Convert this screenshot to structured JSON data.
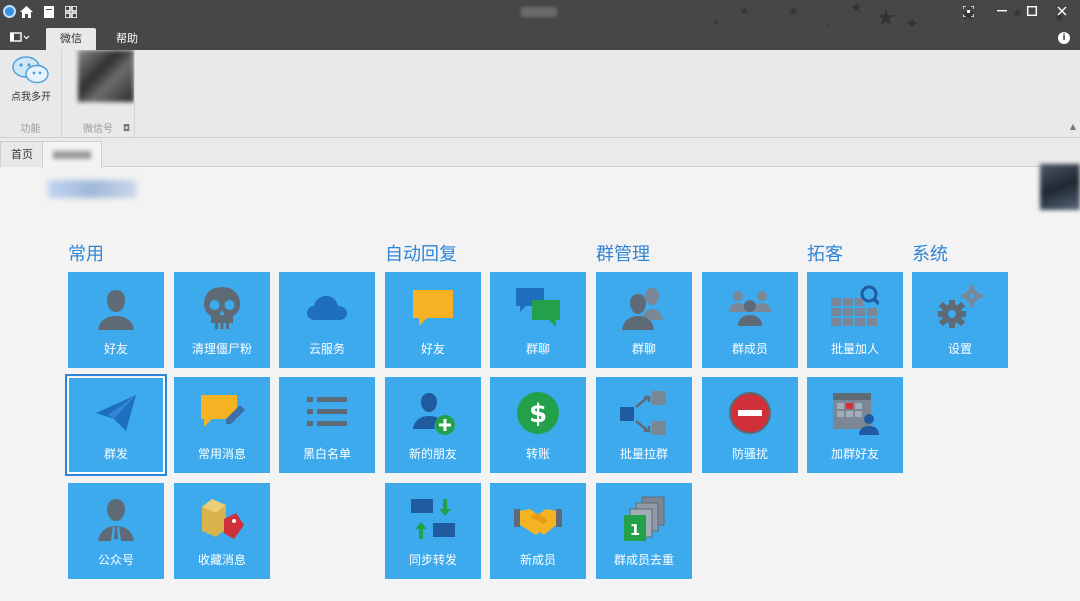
{
  "window": {
    "menu_tabs": [
      {
        "label": "微信",
        "active": true
      },
      {
        "label": "帮助",
        "active": false
      }
    ]
  },
  "ribbon": {
    "groups": [
      {
        "label": "功能",
        "buttons": [
          {
            "label": "点我多开",
            "icon": "wechat-icon"
          }
        ]
      },
      {
        "label": "微信号",
        "buttons": []
      }
    ]
  },
  "page_tabs": [
    {
      "label": "首页",
      "active": false
    },
    {
      "label": "",
      "active": true
    }
  ],
  "sections": [
    {
      "title": "常用"
    },
    {
      "title": "自动回复"
    },
    {
      "title": "群管理"
    },
    {
      "title": "拓客"
    },
    {
      "title": "系统"
    }
  ],
  "tiles": {
    "changyong": [
      {
        "label": "好友",
        "icon": "user-icon"
      },
      {
        "label": "清理僵尸粉",
        "icon": "skull-icon"
      },
      {
        "label": "云服务",
        "icon": "cloud-icon"
      },
      {
        "label": "群发",
        "icon": "paper-plane-icon",
        "selected": true
      },
      {
        "label": "常用消息",
        "icon": "message-edit-icon"
      },
      {
        "label": "黑白名单",
        "icon": "list-icon"
      },
      {
        "label": "公众号",
        "icon": "official-account-icon"
      },
      {
        "label": "收藏消息",
        "icon": "favorite-tag-icon"
      }
    ],
    "zidonghuifu": [
      {
        "label": "好友",
        "icon": "chat-bubble-icon"
      },
      {
        "label": "群聊",
        "icon": "group-chat-icon"
      },
      {
        "label": "新的朋友",
        "icon": "add-friend-icon"
      },
      {
        "label": "转账",
        "icon": "dollar-icon"
      },
      {
        "label": "同步转发",
        "icon": "sync-forward-icon"
      },
      {
        "label": "新成员",
        "icon": "handshake-icon"
      }
    ],
    "qunguanli": [
      {
        "label": "群聊",
        "icon": "group-users-icon"
      },
      {
        "label": "群成员",
        "icon": "members-icon"
      },
      {
        "label": "批量拉群",
        "icon": "batch-pull-icon"
      },
      {
        "label": "防骚扰",
        "icon": "no-entry-icon"
      },
      {
        "label": "群成员去重",
        "icon": "dedupe-icon"
      }
    ],
    "tuoke": [
      {
        "label": "批量加人",
        "icon": "grid-search-icon"
      },
      {
        "label": "加群好友",
        "icon": "calendar-user-icon"
      }
    ],
    "xitong": [
      {
        "label": "设置",
        "icon": "gears-icon"
      }
    ]
  }
}
